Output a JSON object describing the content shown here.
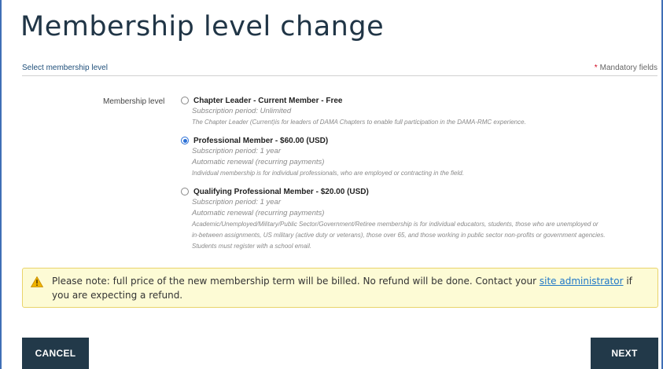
{
  "page": {
    "title": "Membership level change",
    "section_label": "Select membership level",
    "mandatory_label": "Mandatory fields",
    "mandatory_star": "*"
  },
  "form": {
    "field_label": "Membership level",
    "selected_index": 1,
    "options": [
      {
        "title": "Chapter Leader - Current Member - Free",
        "subscription": "Subscription period: Unlimited",
        "renewal": "",
        "description": [
          "The Chapter Leader (Current)is for leaders of DAMA Chapters to enable full participation in the DAMA-RMC experience."
        ]
      },
      {
        "title": "Professional Member - $60.00 (USD)",
        "subscription": "Subscription period: 1 year",
        "renewal": "Automatic renewal (recurring payments)",
        "description": [
          "Individual membership is for individual professionals, who are employed or contracting in the field."
        ]
      },
      {
        "title": "Qualifying Professional Member - $20.00 (USD)",
        "subscription": "Subscription period: 1 year",
        "renewal": "Automatic renewal (recurring payments)",
        "description": [
          "Academic/Unemployed/Military/Public Sector/Government/Retiree membership is for individual educators, students, those who are unemployed or",
          "in-between assignments, US military (active duty or veterans), those over 65, and those working in public sector non-profits or government agencies.",
          "Students must register with a school email."
        ]
      }
    ]
  },
  "notice": {
    "icon": "warning-icon",
    "text_before": "Please note: full price of the new membership term will be billed. No refund will be done. Contact your ",
    "link_text": "site administrator",
    "text_after": " if you are expecting a refund."
  },
  "buttons": {
    "cancel": "CANCEL",
    "next": "NEXT"
  },
  "colors": {
    "title": "#203546",
    "button_bg": "#223949",
    "radio_selected": "#2a6fd6",
    "notice_bg": "#fdfbd5",
    "notice_border": "#e9d46a",
    "link": "#1f77c7",
    "mandatory_star": "#d0021b",
    "frame_border": "#3f6fb6"
  }
}
